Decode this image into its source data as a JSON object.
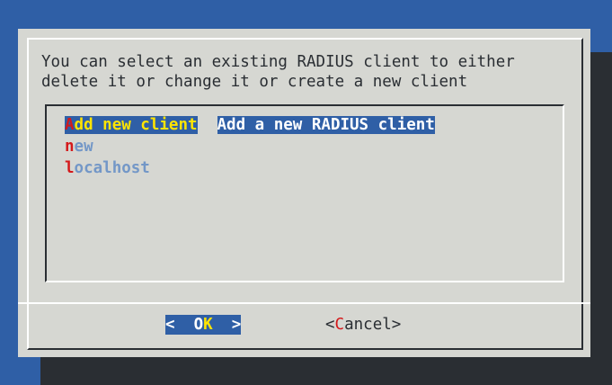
{
  "dialog": {
    "prompt_line1": "You can select an existing RADIUS client to either",
    "prompt_line2": "delete it or change it or create a new client"
  },
  "menu": {
    "items": [
      {
        "hotkey": "A",
        "rest": "dd new client",
        "description": "Add a new RADIUS client",
        "selected": true
      },
      {
        "hotkey": "n",
        "rest": "ew",
        "description": "",
        "selected": false
      },
      {
        "hotkey": "l",
        "rest": "ocalhost",
        "description": "",
        "selected": false
      }
    ]
  },
  "buttons": {
    "ok_pre": "<  ",
    "ok_pre_hot": "O",
    "ok_hot": "K",
    "ok_post": "  >",
    "cancel_pre": "<",
    "cancel_hot": "C",
    "cancel_post": "ancel>"
  },
  "colors": {
    "background": "#2f5fa6",
    "dialog": "#d6d7d2",
    "hotkey": "#d4191b",
    "selected_text": "#ffe400",
    "item_text": "#7397c7"
  }
}
